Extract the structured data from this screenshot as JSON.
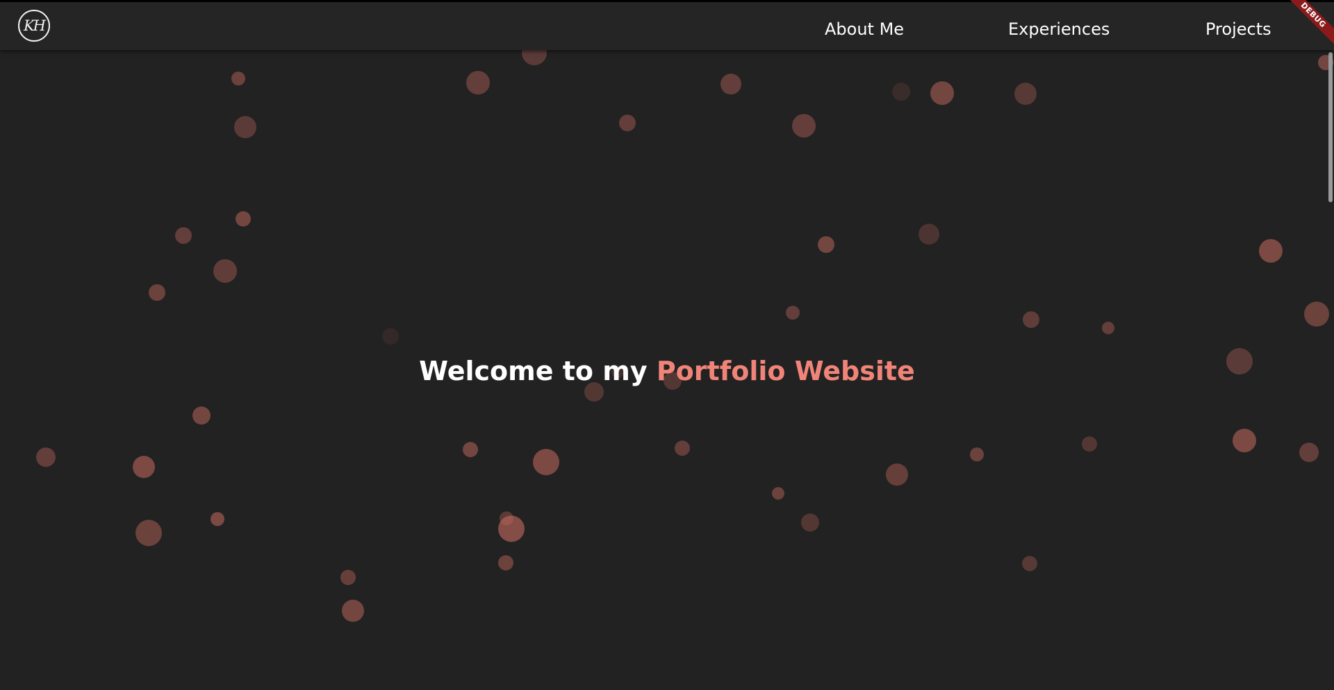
{
  "header": {
    "logo_text": "KH",
    "nav": [
      {
        "label": "About Me"
      },
      {
        "label": "Experiences"
      },
      {
        "label": "Projects"
      }
    ],
    "debug_label": "DEBUG"
  },
  "hero": {
    "text_prefix": "Welcome to my ",
    "text_highlight": "Portfolio Website"
  },
  "colors": {
    "background": "#222222",
    "navbar": "#252525",
    "accent": "#f08478",
    "bubble": "#c66a5e",
    "debug_banner": "#8b1b1b"
  }
}
